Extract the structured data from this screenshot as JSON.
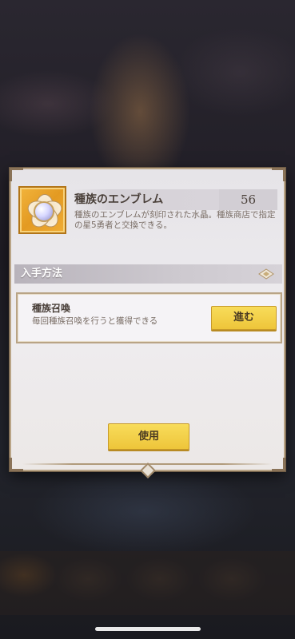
{
  "item": {
    "name": "種族のエンブレム",
    "count": "56",
    "description": "種族のエンブレムが刻印された水晶。種族商店で指定の星5勇者と交換できる。",
    "icon": "race-emblem-crystal-icon"
  },
  "acquisition": {
    "section_title": "入手方法",
    "methods": [
      {
        "title": "種族召喚",
        "description": "毎回種族召喚を行うと獲得できる",
        "button_label": "進む"
      }
    ]
  },
  "actions": {
    "use_label": "使用"
  },
  "colors": {
    "accent_button": "#eec53a",
    "item_frame": "#e39a22",
    "dialog_border": "#b9a486"
  }
}
